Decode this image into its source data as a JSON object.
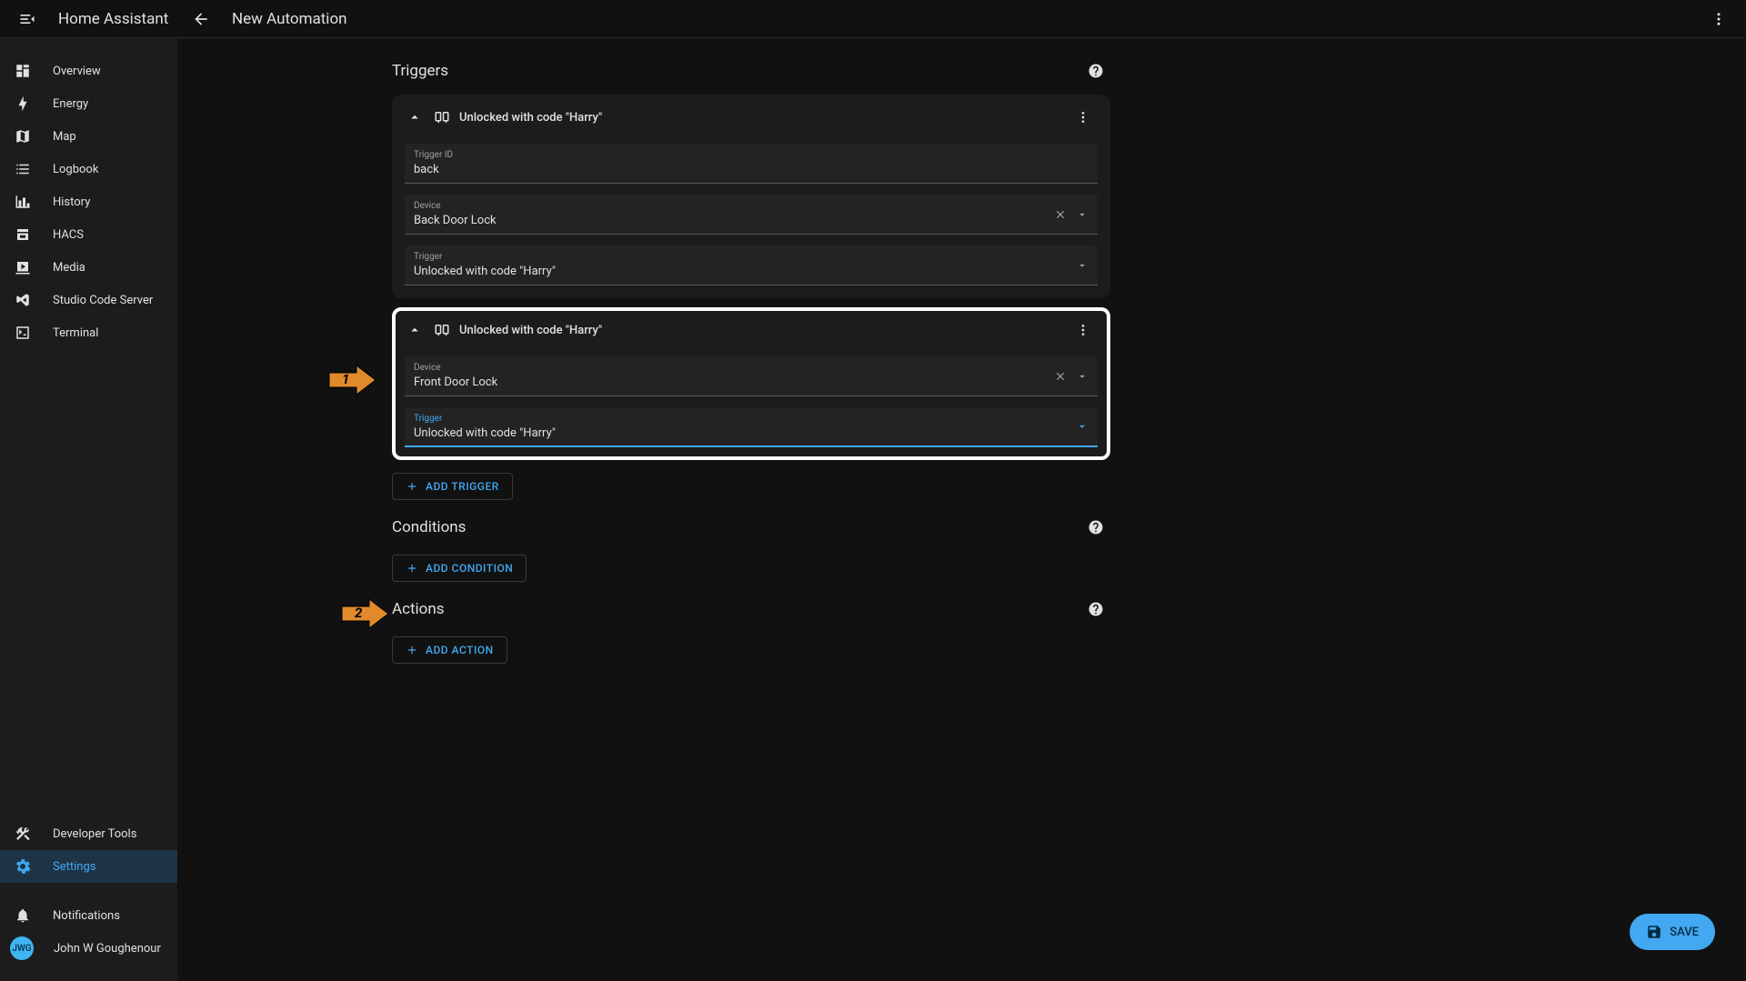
{
  "header": {
    "app_title": "Home Assistant",
    "page_title": "New Automation"
  },
  "sidebar": {
    "items": [
      {
        "label": "Overview"
      },
      {
        "label": "Energy"
      },
      {
        "label": "Map"
      },
      {
        "label": "Logbook"
      },
      {
        "label": "History"
      },
      {
        "label": "HACS"
      },
      {
        "label": "Media"
      },
      {
        "label": "Studio Code Server"
      },
      {
        "label": "Terminal"
      }
    ],
    "bottom": {
      "dev_tools": "Developer Tools",
      "settings": "Settings",
      "notifications": "Notifications",
      "user_name": "John W Goughenour",
      "user_initials": "JWG"
    }
  },
  "sections": {
    "triggers": {
      "title": "Triggers",
      "add_label": "ADD TRIGGER"
    },
    "conditions": {
      "title": "Conditions",
      "add_label": "ADD CONDITION"
    },
    "actions": {
      "title": "Actions",
      "add_label": "ADD ACTION"
    }
  },
  "triggers": [
    {
      "title": "Unlocked with code \"Harry\"",
      "fields": {
        "trigger_id": {
          "label": "Trigger ID",
          "value": "back"
        },
        "device": {
          "label": "Device",
          "value": "Back Door Lock"
        },
        "trigger": {
          "label": "Trigger",
          "value": "Unlocked with code \"Harry\""
        }
      }
    },
    {
      "title": "Unlocked with code \"Harry\"",
      "fields": {
        "device": {
          "label": "Device",
          "value": "Front Door Lock"
        },
        "trigger": {
          "label": "Trigger",
          "value": "Unlocked with code \"Harry\""
        }
      }
    }
  ],
  "fab": {
    "save": "SAVE"
  },
  "annotations": {
    "arrow1": "1",
    "arrow2": "2"
  }
}
